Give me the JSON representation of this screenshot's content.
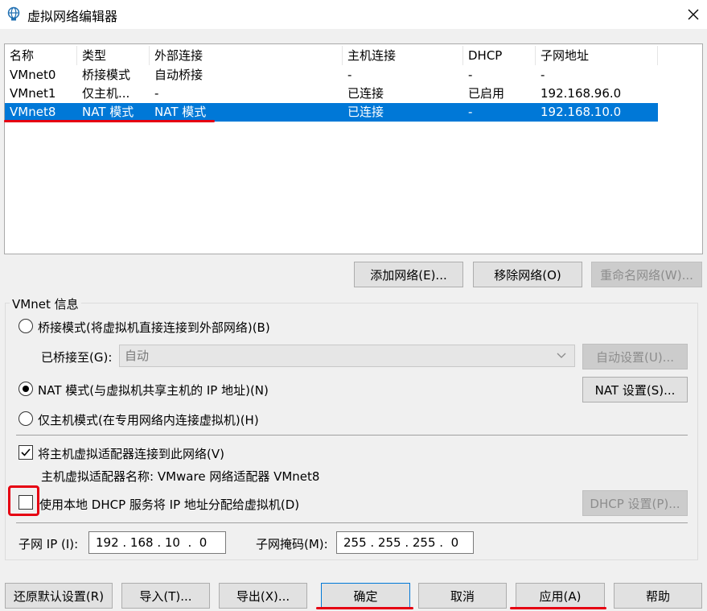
{
  "window": {
    "title": "虚拟网络编辑器",
    "app_icon": "network-globe-icon",
    "close_icon": "close-icon"
  },
  "table": {
    "headers": [
      "名称",
      "类型",
      "外部连接",
      "主机连接",
      "DHCP",
      "子网地址"
    ],
    "rows": [
      [
        "VMnet0",
        "桥接模式",
        "自动桥接",
        "-",
        "-",
        "-"
      ],
      [
        "VMnet1",
        "仅主机...",
        "-",
        "已连接",
        "已启用",
        "192.168.96.0"
      ],
      [
        "VMnet8",
        "NAT 模式",
        "NAT 模式",
        "已连接",
        "-",
        "192.168.10.0"
      ]
    ],
    "selected_row": 2,
    "selection_color": "#0078d7"
  },
  "table_buttons": {
    "add": "添加网络(E)...",
    "remove": "移除网络(O)",
    "rename": "重命名网络(W)..."
  },
  "vmnet_info": {
    "legend": "VMnet 信息",
    "bridged_label": "桥接模式(将虚拟机直接连接到外部网络)(B)",
    "bridged_to_label": "已桥接至(G):",
    "bridged_to_value": "自动",
    "auto_settings_button": "自动设置(U)...",
    "nat_label": "NAT 模式(与虚拟机共享主机的 IP 地址)(N)",
    "nat_settings_button": "NAT 设置(S)...",
    "hostonly_label": "仅主机模式(在专用网络内连接虚拟机)(H)",
    "selected_mode": "nat",
    "connect_adapter_label": "将主机虚拟适配器连接到此网络(V)",
    "connect_adapter_checked": true,
    "adapter_name_text": "主机虚拟适配器名称: VMware 网络适配器 VMnet8",
    "dhcp_label": "使用本地 DHCP 服务将 IP 地址分配给虚拟机(D)",
    "dhcp_checked": false,
    "dhcp_settings_button": "DHCP 设置(P)...",
    "subnet_ip_label": "子网 IP (I):",
    "subnet_ip_value": "192 . 168 . 10  .  0",
    "subnet_mask_label": "子网掩码(M):",
    "subnet_mask_value": "255 . 255 . 255 .  0"
  },
  "footer_buttons": {
    "restore": "还原默认设置(R)",
    "import": "导入(T)...",
    "export": "导出(X)...",
    "ok": "确定",
    "cancel": "取消",
    "apply": "应用(A)",
    "help": "帮助"
  },
  "annotation_color": "#e60012"
}
